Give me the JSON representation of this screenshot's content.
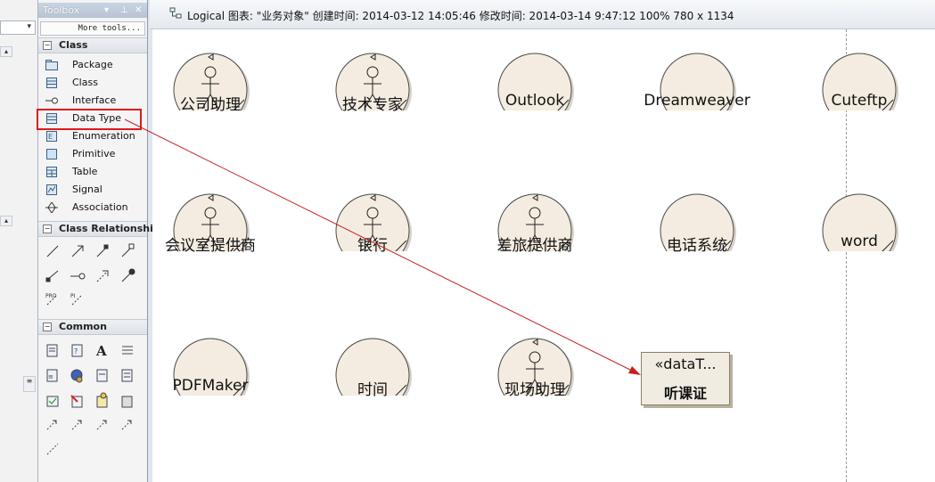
{
  "toolbox": {
    "title": "Toolbox",
    "more_tools": "More tools...",
    "sections": {
      "class": "Class",
      "class_relationships": "Class Relationshi...",
      "common": "Common"
    },
    "class_items": [
      "Package",
      "Class",
      "Interface",
      "Data Type",
      "Enumeration",
      "Primitive",
      "Table",
      "Signal",
      "Association"
    ],
    "highlighted_item": "Data Type"
  },
  "diagram": {
    "title_bar": "Logical 图表: \"业务对象\"  创建时间: 2014-03-12 14:05:46  修改时间: 2014-03-14 9:47:12  100%   780 x 1134",
    "actors": [
      {
        "label": "公司助理",
        "stick_figure": true
      },
      {
        "label": "技术专家",
        "stick_figure": true
      },
      {
        "label": "Outlook",
        "stick_figure": false
      },
      {
        "label": "Dreamweaver",
        "stick_figure": false
      },
      {
        "label": "Cuteftp",
        "stick_figure": false
      },
      {
        "label": "会议室提供商",
        "stick_figure": true
      },
      {
        "label": "银行",
        "stick_figure": true
      },
      {
        "label": "差旅提供商",
        "stick_figure": true
      },
      {
        "label": "电话系统",
        "stick_figure": false
      },
      {
        "label": "word",
        "stick_figure": false
      },
      {
        "label": "PDFMaker",
        "stick_figure": false
      },
      {
        "label": "时间",
        "stick_figure": false
      },
      {
        "label": "现场助理",
        "stick_figure": true
      }
    ],
    "datatype_element": {
      "stereotype": "«dataT...",
      "name": "听课证"
    }
  },
  "colors": {
    "actor_fill": "#f4ece0",
    "highlight": "#e0191b",
    "arrow": "#c62020"
  }
}
